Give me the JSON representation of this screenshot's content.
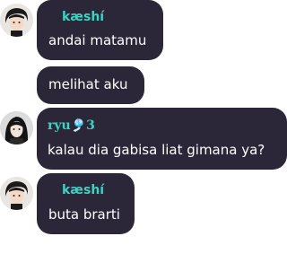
{
  "messages": [
    {
      "sender": "kæshí",
      "text": "andai matamu",
      "show_avatar": true,
      "show_name": true
    },
    {
      "sender": "",
      "text": "melihat aku",
      "show_avatar": false,
      "show_name": false
    },
    {
      "sender": "ryu🎐3",
      "text": "kalau dia gabisa liat gimana ya?",
      "show_avatar": true,
      "show_name": true
    },
    {
      "sender": "kæshí",
      "text": "buta brarti",
      "show_avatar": true,
      "show_name": true
    }
  ],
  "colors": {
    "bubble": "#2b2738",
    "name": "#3fd1c2",
    "text": "#ffffff"
  }
}
